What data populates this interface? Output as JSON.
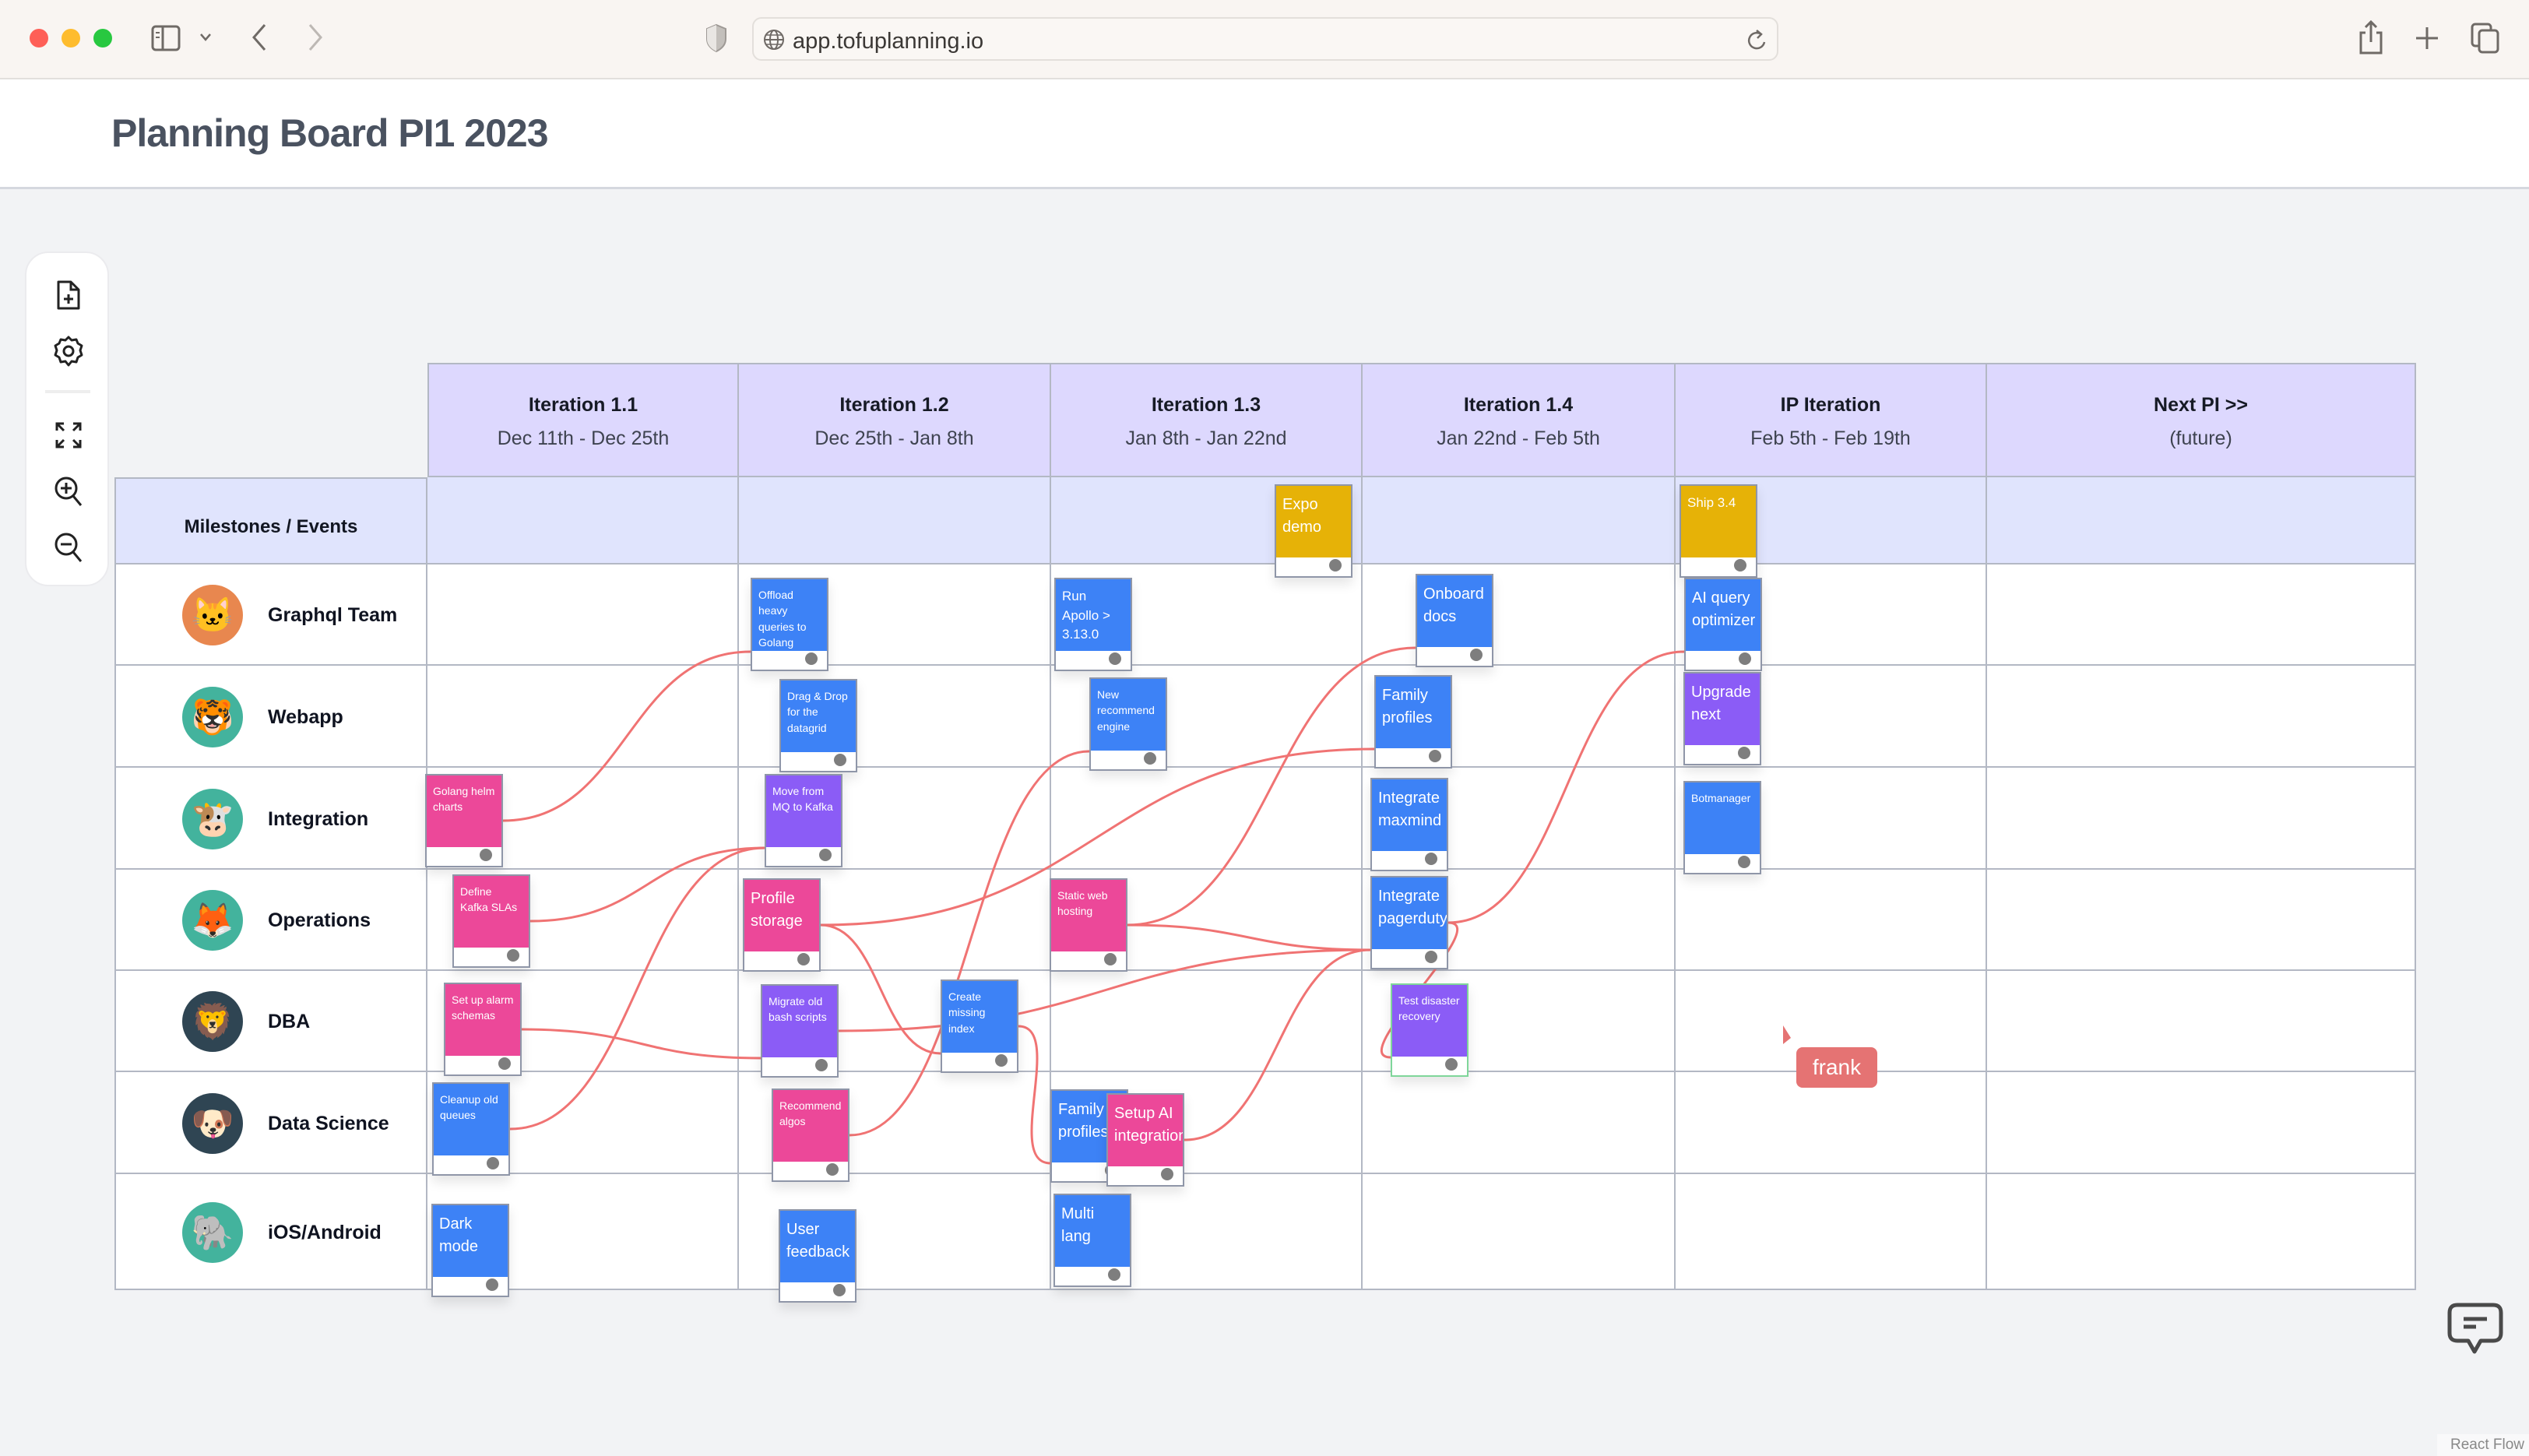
{
  "browser": {
    "url": "app.tofuplanning.io",
    "icons": [
      "sidebar-toggle-icon",
      "chevron-down-icon",
      "back-icon",
      "forward-icon",
      "shield-icon",
      "globe-icon",
      "reload-icon",
      "share-icon",
      "new-tab-icon",
      "tab-overview-icon"
    ]
  },
  "page": {
    "title": "Planning Board PI1 2023"
  },
  "toolbar": {
    "items": [
      "new-document-icon",
      "settings-icon",
      "fit-view-icon",
      "zoom-in-icon",
      "zoom-out-icon"
    ]
  },
  "board": {
    "columns": [
      {
        "title": "Iteration 1.1",
        "dates": "Dec 11th - Dec 25th"
      },
      {
        "title": "Iteration 1.2",
        "dates": "Dec 25th - Jan 8th"
      },
      {
        "title": "Iteration 1.3",
        "dates": "Jan 8th - Jan 22nd"
      },
      {
        "title": "Iteration 1.4",
        "dates": "Jan 22nd - Feb 5th"
      },
      {
        "title": "IP Iteration",
        "dates": "Feb 5th - Feb 19th"
      },
      {
        "title": "Next PI >>",
        "dates": "(future)"
      }
    ],
    "milestones_label": "Milestones / Events",
    "teams": [
      {
        "name": "Graphql Team",
        "avatar": "cat",
        "avatar_bg": "#e8874f"
      },
      {
        "name": "Webapp",
        "avatar": "tiger",
        "avatar_bg": "#43b39d"
      },
      {
        "name": "Integration",
        "avatar": "cow",
        "avatar_bg": "#43b39d"
      },
      {
        "name": "Operations",
        "avatar": "fox",
        "avatar_bg": "#43b39d"
      },
      {
        "name": "DBA",
        "avatar": "lion",
        "avatar_bg": "#2f4553"
      },
      {
        "name": "Data Science",
        "avatar": "bulldog",
        "avatar_bg": "#2f4553"
      },
      {
        "name": "iOS/Android",
        "avatar": "elephant",
        "avatar_bg": "#43b39d"
      }
    ],
    "colors": {
      "blue": "#3d82f6",
      "pink": "#ec4899",
      "purple": "#8b5cf6",
      "gold": "#e6b207",
      "edge": "#f07373"
    },
    "cards": [
      {
        "id": "expo",
        "text": "Expo demo",
        "color": "gold",
        "col": 2,
        "row": "milestones",
        "size": "md"
      },
      {
        "id": "ship",
        "text": "Ship 3.4",
        "color": "gold",
        "col": 4,
        "row": "milestones",
        "size": "sm"
      },
      {
        "id": "offload",
        "text": "Offload heavy queries to Golang",
        "color": "blue",
        "col": 1,
        "row": 0,
        "size": "xs"
      },
      {
        "id": "apollo",
        "text": "Run Apollo > 3.13.0",
        "color": "blue",
        "col": 2,
        "row": 0,
        "size": "sm"
      },
      {
        "id": "onboard",
        "text": "Onboard docs",
        "color": "blue",
        "col": 3,
        "row": 0,
        "size": "md"
      },
      {
        "id": "aiquery",
        "text": "AI query optimizer",
        "color": "blue",
        "col": 4,
        "row": 0,
        "size": "md"
      },
      {
        "id": "dragdrop",
        "text": "Drag & Drop for the datagrid",
        "color": "blue",
        "col": 1,
        "row": 1,
        "size": "xs"
      },
      {
        "id": "newrec",
        "text": "New recommend engine",
        "color": "blue",
        "col": 2,
        "row": 1,
        "size": "xs"
      },
      {
        "id": "family1",
        "text": "Family profiles",
        "color": "blue",
        "col": 3,
        "row": 1,
        "size": "md"
      },
      {
        "id": "upgrade",
        "text": "Upgrade next",
        "color": "purple",
        "col": 4,
        "row": 1,
        "size": "md"
      },
      {
        "id": "golang",
        "text": "Golang helm charts",
        "color": "pink",
        "col": 0,
        "row": 2,
        "size": "xs"
      },
      {
        "id": "mq",
        "text": "Move from MQ to Kafka",
        "color": "purple",
        "col": 1,
        "row": 2,
        "size": "xs"
      },
      {
        "id": "maxmind",
        "text": "Integrate maxmind",
        "color": "blue",
        "col": 3,
        "row": 2,
        "size": "md"
      },
      {
        "id": "botmanager",
        "text": "Botmanager",
        "color": "blue",
        "col": 4,
        "row": 2,
        "size": "xs"
      },
      {
        "id": "kafkasla",
        "text": "Define Kafka SLAs",
        "color": "pink",
        "col": 0,
        "row": 3,
        "size": "xs"
      },
      {
        "id": "profile",
        "text": "Profile storage",
        "color": "pink",
        "col": 1,
        "row": 3,
        "size": "md"
      },
      {
        "id": "staticweb",
        "text": "Static web hosting",
        "color": "pink",
        "col": 2,
        "row": 3,
        "size": "xs"
      },
      {
        "id": "pagerduty",
        "text": "Integrate pagerduty",
        "color": "blue",
        "col": 3,
        "row": 3,
        "size": "md"
      },
      {
        "id": "alarm",
        "text": "Set up alarm schemas",
        "color": "pink",
        "col": 0,
        "row": 4,
        "size": "xs"
      },
      {
        "id": "bash",
        "text": "Migrate old bash scripts",
        "color": "purple",
        "col": 1,
        "row": 4,
        "size": "xs"
      },
      {
        "id": "index",
        "text": "Create missing index",
        "color": "blue",
        "col": 1,
        "row": 4,
        "size": "xs"
      },
      {
        "id": "disaster",
        "text": "Test disaster recovery",
        "color": "purple",
        "col": 3,
        "row": 4,
        "size": "xs"
      },
      {
        "id": "cleanup",
        "text": "Cleanup old queues",
        "color": "blue",
        "col": 0,
        "row": 5,
        "size": "xs"
      },
      {
        "id": "recalgos",
        "text": "Recommend algos",
        "color": "pink",
        "col": 1,
        "row": 5,
        "size": "xs"
      },
      {
        "id": "family2",
        "text": "Family profiles",
        "color": "blue",
        "col": 2,
        "row": 5,
        "size": "md"
      },
      {
        "id": "setupai",
        "text": "Setup AI integration",
        "color": "pink",
        "col": 2,
        "row": 5,
        "size": "md"
      },
      {
        "id": "darkmode",
        "text": "Dark mode",
        "color": "blue",
        "col": 0,
        "row": 6,
        "size": "md"
      },
      {
        "id": "feedback",
        "text": "User feedback",
        "color": "blue",
        "col": 1,
        "row": 6,
        "size": "md"
      },
      {
        "id": "multilang",
        "text": "Multi lang",
        "color": "blue",
        "col": 2,
        "row": 6,
        "size": "md"
      }
    ],
    "dependencies": [
      [
        "golang",
        "offload"
      ],
      [
        "kafkasla",
        "mq"
      ],
      [
        "cleanup",
        "mq"
      ],
      [
        "alarm",
        "bash"
      ],
      [
        "profile",
        "family1"
      ],
      [
        "profile",
        "index"
      ],
      [
        "recalgos",
        "newrec"
      ],
      [
        "bash",
        "pagerduty"
      ],
      [
        "staticweb",
        "onboard"
      ],
      [
        "staticweb",
        "pagerduty"
      ],
      [
        "index",
        "family2"
      ],
      [
        "setupai",
        "pagerduty"
      ],
      [
        "pagerduty",
        "aiquery"
      ],
      [
        "pagerduty",
        "disaster"
      ]
    ]
  },
  "presence": {
    "cursor_user": "frank",
    "cursor_color": "#e57373"
  },
  "footer": {
    "comments_icon": "comment-icon",
    "attribution": "React Flow"
  }
}
